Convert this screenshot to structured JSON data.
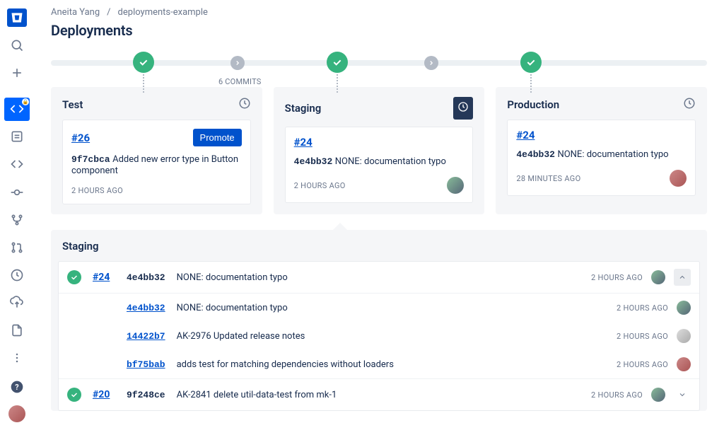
{
  "breadcrumb": {
    "owner": "Aneita Yang",
    "repo": "deployments-example"
  },
  "page_title": "Deployments",
  "commits_label": "6 COMMITS",
  "environments": {
    "test": {
      "name": "Test",
      "num": "#26",
      "promote": "Promote",
      "hash": "9f7cbca",
      "msg": "Added new error type in Button component",
      "time": "2 HOURS AGO"
    },
    "staging": {
      "name": "Staging",
      "num": "#24",
      "hash": "4e4bb32",
      "msg": "NONE: documentation typo",
      "time": "2 HOURS AGO"
    },
    "production": {
      "name": "Production",
      "num": "#24",
      "hash": "4e4bb32",
      "msg": "NONE: documentation typo",
      "time": "28 MINUTES AGO"
    }
  },
  "detail": {
    "title": "Staging",
    "rows": [
      {
        "status": "success",
        "num": "#24",
        "hash": "4e4bb32",
        "msg": "NONE: documentation typo",
        "time": "2 HOURS AGO",
        "expanded": true
      },
      {
        "hash": "4e4bb32",
        "msg": "NONE: documentation typo",
        "time": "2 HOURS AGO"
      },
      {
        "hash": "14422b7",
        "msg": "AK-2976 Updated release notes",
        "time": "2 HOURS AGO"
      },
      {
        "hash": "bf75bab",
        "msg": "adds test for matching dependencies without loaders",
        "time": "2 HOURS AGO"
      },
      {
        "status": "success",
        "num": "#20",
        "hash": "9f248ce",
        "msg": "AK-2841 delete util-data-test from mk-1",
        "time": "2 HOURS AGO",
        "expanded": false
      }
    ]
  }
}
